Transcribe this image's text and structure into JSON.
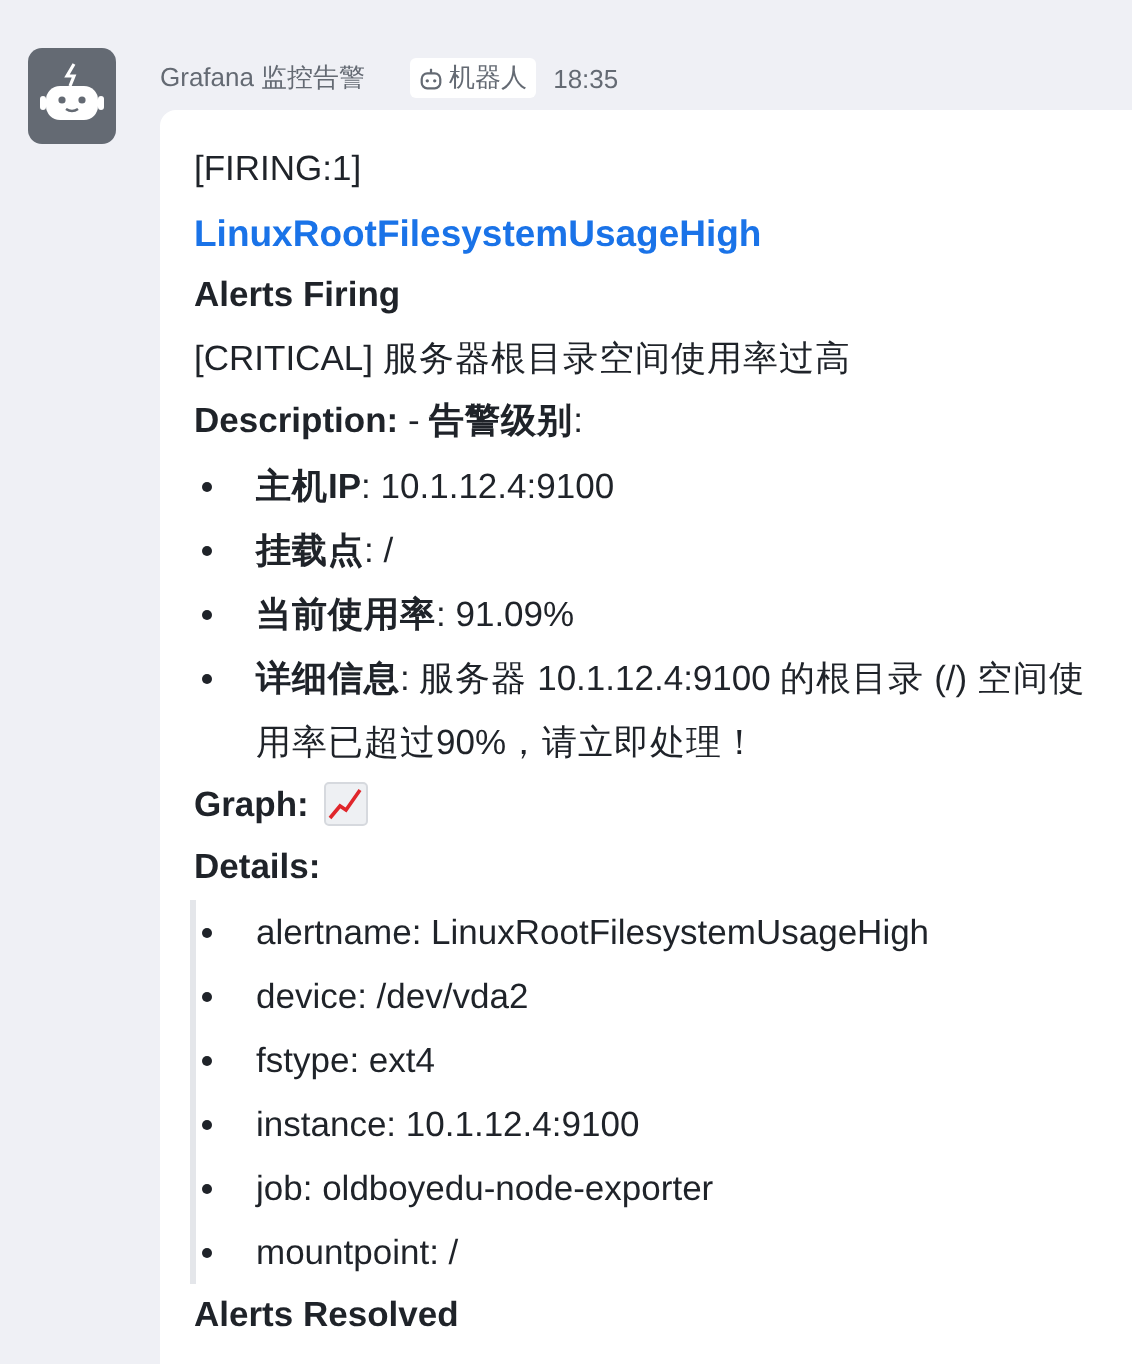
{
  "sender": {
    "name": "Grafana 监控告警",
    "badge": "机器人",
    "time": "18:35"
  },
  "message": {
    "title": "[FIRING:1]",
    "link": "LinuxRootFilesystemUsageHigh",
    "blocks": [
      {
        "kind": "heading",
        "text": "Alerts Firing"
      },
      {
        "kind": "text",
        "text": "[CRITICAL] 服务器根目录空间使用率过高"
      },
      {
        "kind": "text",
        "text": "**Description:** - **告警级别**:"
      },
      {
        "kind": "list",
        "items": [
          "**主机IP**: 10.1.12.4:9100",
          "**挂载点**: /",
          "**当前使用率**: 91.09%",
          "**详细信息**: 服务器 10.1.12.4:9100 的根目录 (/) 空间使用率已超过90%，请立即处理！"
        ]
      },
      {
        "kind": "graph",
        "text": "Graph:"
      },
      {
        "kind": "heading",
        "text": "Details:"
      },
      {
        "kind": "quote_list",
        "items": [
          "alertname: LinuxRootFilesystemUsageHigh",
          "device: /dev/vda2",
          "fstype: ext4",
          "instance: 10.1.12.4:9100",
          "job: oldboyedu-node-exporter",
          "mountpoint: /"
        ]
      },
      {
        "kind": "heading",
        "text": "Alerts Resolved"
      }
    ]
  }
}
